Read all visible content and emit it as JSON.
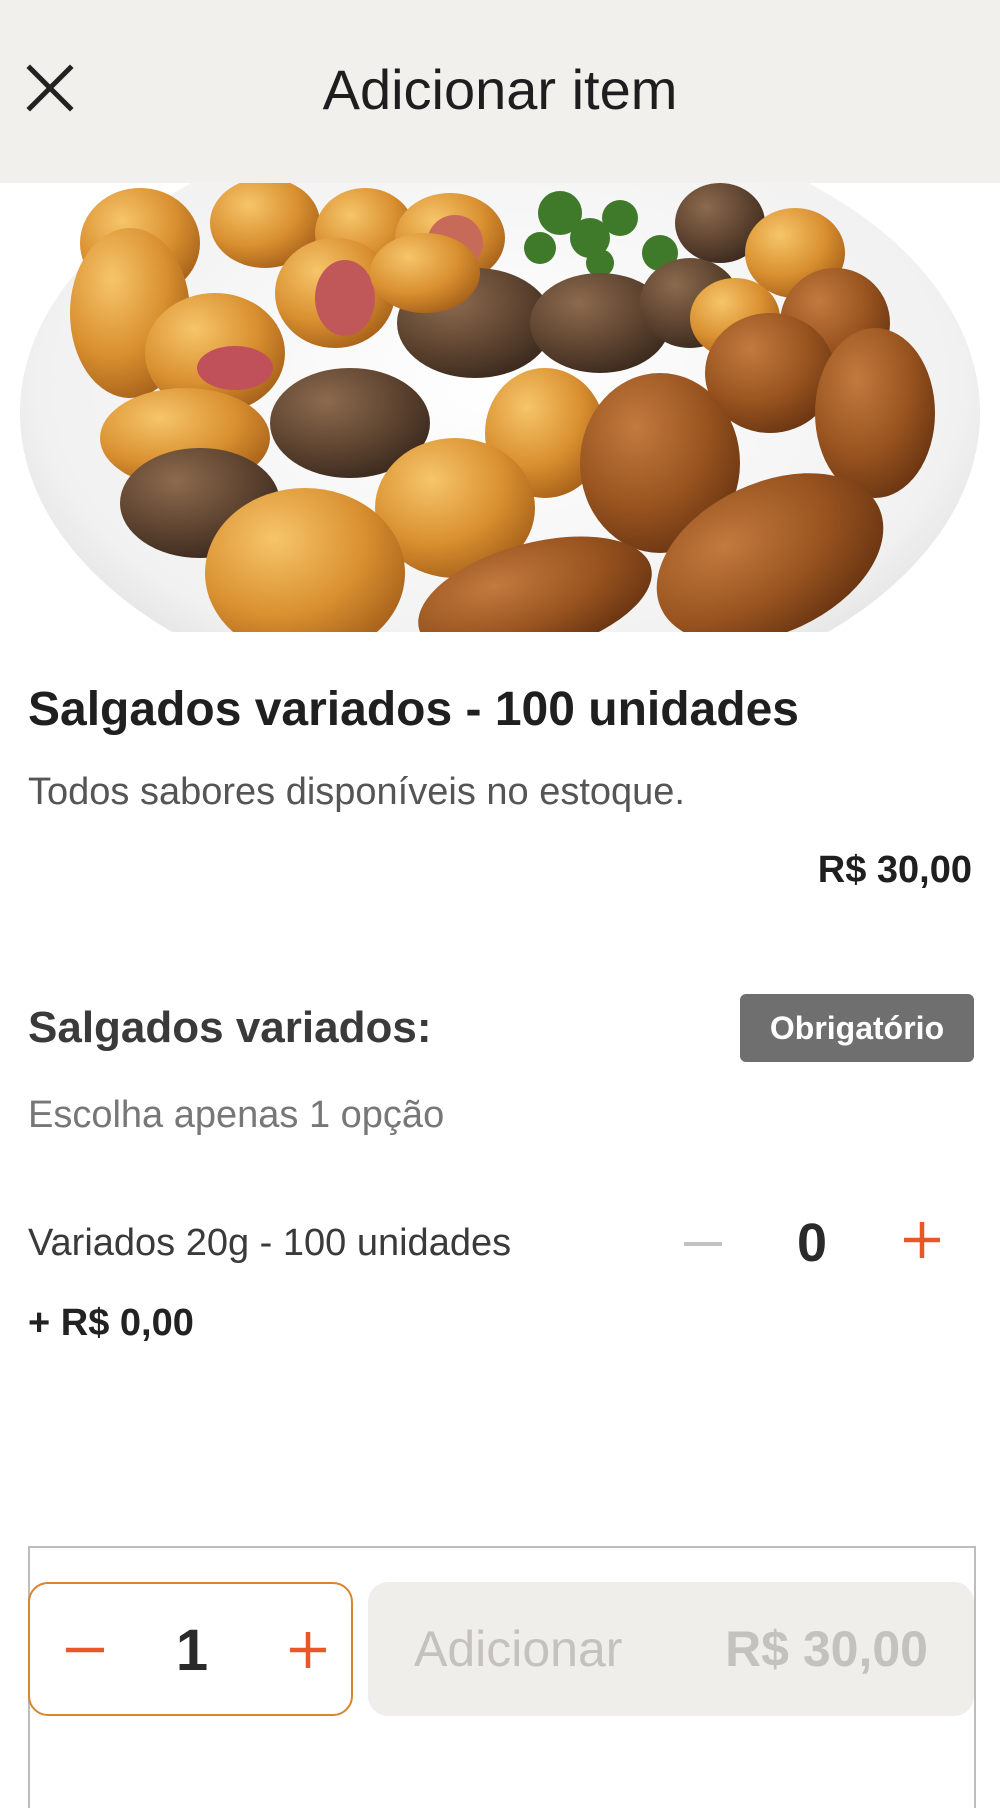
{
  "header": {
    "title": "Adicionar item",
    "close_icon": "close-icon"
  },
  "product": {
    "image_icon": "food-photo",
    "name": "Salgados variados - 100 unidades",
    "description": "Todos sabores disponíveis no estoque.",
    "price": "R$ 30,00"
  },
  "option_group": {
    "title": "Salgados variados:",
    "badge": "Obrigatório",
    "hint": "Escolha apenas 1 opção",
    "options": [
      {
        "label": "Variados 20g - 100 unidades",
        "price": "+ R$ 0,00",
        "quantity": "0",
        "minus_icon": "minus-icon",
        "plus_icon": "plus-icon"
      }
    ]
  },
  "footer": {
    "quantity": "1",
    "add_label": "Adicionar",
    "total": "R$ 30,00"
  },
  "colors": {
    "accent": "#e8562a",
    "header_bg": "#f2f0ed",
    "badge_bg": "#6f6f6f",
    "qty_border": "#d8852e",
    "add_button_bg": "#f0eeeb",
    "disabled_text": "#c4c2bf"
  }
}
